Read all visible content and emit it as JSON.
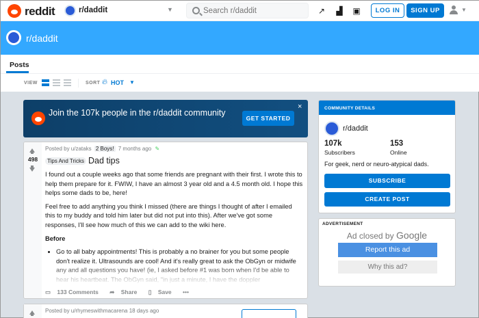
{
  "header": {
    "logo_text": "reddit",
    "subreddit": "r/daddit",
    "search_placeholder": "Search r/daddit",
    "login": "LOG IN",
    "signup": "SIGN UP"
  },
  "banner": {
    "title": "r/daddit"
  },
  "tabs": [
    {
      "label": "Posts",
      "active": true
    }
  ],
  "sortbar": {
    "view_label": "VIEW",
    "sort_label": "SORT",
    "sort_value": "HOT"
  },
  "join_card": {
    "text": "Join the 107k people in the r/daddit community",
    "button": "GET STARTED",
    "close": "×"
  },
  "post": {
    "score": "498",
    "meta_prefix": "Posted by u/zataks",
    "user_flair": "2 Boys!",
    "time": "7 months ago",
    "flair": "Tips And Tricks",
    "title": "Dad tips",
    "p1": "I found out a couple weeks ago that some friends are pregnant with their first. I wrote this to help them prepare for it. FWIW, I have an almost 3 year old and a 4.5 month old. I hope this helps some dads to be, here!",
    "p2": "Feel free to add anything you think I missed (there are things I thought of after I emailed this to my buddy and told him later but did not put into this). After we've got some responses, I'll see how much of this we can add to the wiki here.",
    "heading": "Before",
    "bullet1": "Go to all baby appointments!  This is probably a no brainer for you but some people don't realize it.  Ultrasounds are cool!  And it's really great to ask the ObGyn or midwife any and all questions you have!  (ie, I asked before #1 was born when I'd be able to hear his heartbeat.  The ObGyn said, \"in just a minute, I have the doppler",
    "comments": "133 Comments",
    "share": "Share",
    "save": "Save",
    "more": "•••"
  },
  "post2": {
    "meta": "Posted by u/rhymeswithmacarena 18 days ago"
  },
  "community": {
    "header": "COMMUNITY DETAILS",
    "name": "r/daddit",
    "subscribers": "107k",
    "subscribers_label": "Subscribers",
    "online": "153",
    "online_label": "Online",
    "description": "For geek, nerd or neuro-atypical dads.",
    "subscribe": "SUBSCRIBE",
    "create_post": "CREATE POST"
  },
  "ad": {
    "label": "ADVERTISEMENT",
    "closed_by": "Ad closed by",
    "google": "Google",
    "report": "Report this ad",
    "why": "Why this ad?"
  },
  "colors": {
    "accent": "#0079d3",
    "banner": "#33a8ff",
    "brand": "#ff4500"
  }
}
